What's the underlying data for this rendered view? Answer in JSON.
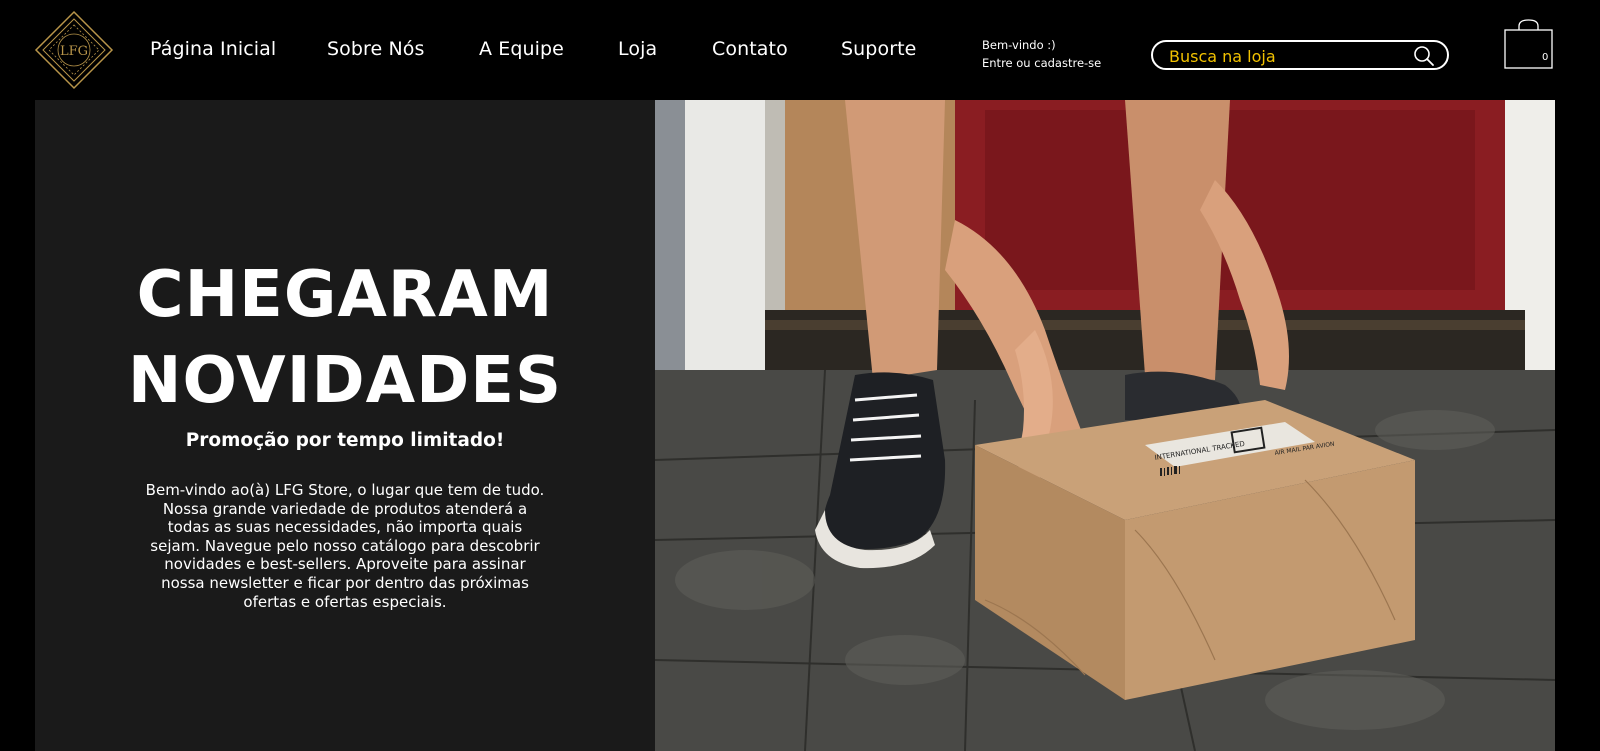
{
  "brand": {
    "logo_text": "LFG"
  },
  "nav": {
    "items": [
      {
        "label": "Página Inicial"
      },
      {
        "label": "Sobre Nós"
      },
      {
        "label": "A Equipe"
      },
      {
        "label": "Loja"
      },
      {
        "label": "Contato"
      },
      {
        "label": "Suporte"
      }
    ]
  },
  "account": {
    "greeting": "Bem-vindo :)",
    "login_label": "Entre ou cadastre-se"
  },
  "search": {
    "placeholder": "Busca na loja",
    "icon": "search-icon"
  },
  "cart": {
    "count": "0",
    "icon": "shopping-bag-icon"
  },
  "hero": {
    "title_line1": "CHEGARAM",
    "title_line2": "NOVIDADES",
    "subtitle": "Promoção por tempo limitado!",
    "body": "Bem-vindo ao(à) LFG Store, o lugar que tem de tudo. Nossa grande variedade de produtos atenderá a todas as suas necessidades, não importa quais sejam. Navegue pelo nosso catálogo para descobrir novidades e best-sellers. Aproveite para assinar nossa newsletter e ficar por dentro das próximas ofertas e ofertas especiais.",
    "image_package_label": "INTERNATIONAL TRACKED",
    "image_package_label2": "AIR MAIL PAR AVION"
  },
  "colors": {
    "background": "#000000",
    "panel": "#1a1a1a",
    "accent_gold": "#b8954a",
    "search_text": "#f2c200"
  }
}
